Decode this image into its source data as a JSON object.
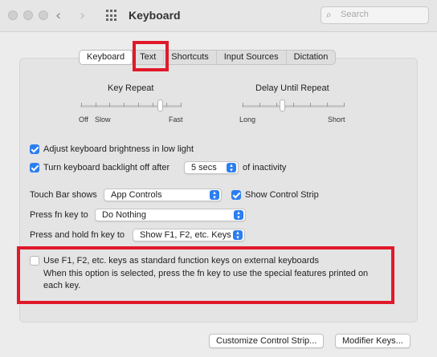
{
  "window": {
    "title": "Keyboard"
  },
  "search": {
    "placeholder": "Search"
  },
  "icons": {
    "back": "chevron-left-icon",
    "forward": "chevron-right-icon",
    "grid": "grid-icon",
    "search": "magnifier-icon"
  },
  "tabs": [
    {
      "label": "Keyboard",
      "selected": true
    },
    {
      "label": "Text",
      "selected": false
    },
    {
      "label": "Shortcuts",
      "selected": false
    },
    {
      "label": "Input Sources",
      "selected": false
    },
    {
      "label": "Dictation",
      "selected": false
    }
  ],
  "key_repeat": {
    "title": "Key Repeat",
    "label_off": "Off",
    "label_slow": "Slow",
    "label_fast": "Fast",
    "level": 0.8
  },
  "delay_until_repeat": {
    "title": "Delay Until Repeat",
    "label_long": "Long",
    "label_short": "Short",
    "level": 0.4
  },
  "brightness": {
    "label": "Adjust keyboard brightness in low light",
    "checked": true
  },
  "backlight": {
    "label": "Turn keyboard backlight off after",
    "value": "5 secs",
    "suffix": "of inactivity",
    "checked": true
  },
  "touch_bar": {
    "label": "Touch Bar shows",
    "value": "App Controls"
  },
  "control_strip": {
    "label": "Show Control Strip",
    "checked": true
  },
  "fn_press": {
    "label": "Press fn key to",
    "value": "Do Nothing"
  },
  "fn_hold": {
    "label": "Press and hold fn key to",
    "value": "Show F1, F2, etc. Keys"
  },
  "function_keys": {
    "label": "Use F1, F2, etc. keys as standard function keys on external keyboards",
    "description_line1": "When this option is selected, press the fn key to use the special features printed on",
    "description_line2": "each key.",
    "checked": false
  },
  "buttons": {
    "customize": "Customize Control Strip...",
    "modifier": "Modifier Keys..."
  },
  "colors": {
    "accent": "#2b7ef1",
    "highlight": "#e0192a"
  }
}
